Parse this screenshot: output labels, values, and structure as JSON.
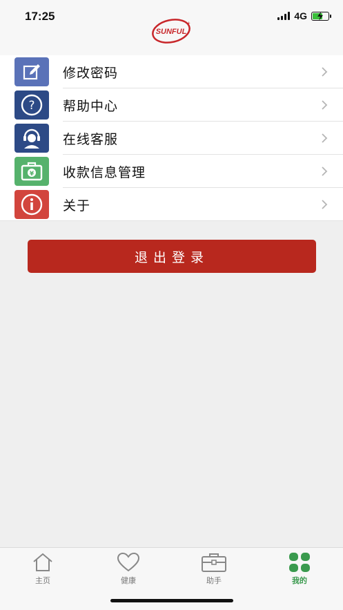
{
  "status": {
    "time": "17:25",
    "network": "4G"
  },
  "logo": {
    "text": "SUNFUL"
  },
  "menu": [
    {
      "label": "修改密码",
      "icon": "edit-icon",
      "color": "#5a72b8"
    },
    {
      "label": "帮助中心",
      "icon": "help-icon",
      "color": "#2d4a86"
    },
    {
      "label": "在线客服",
      "icon": "customer-service-icon",
      "color": "#2d4a86"
    },
    {
      "label": "收款信息管理",
      "icon": "wallet-icon",
      "color": "#56b26c"
    },
    {
      "label": "关于",
      "icon": "info-icon",
      "color": "#d2453d"
    }
  ],
  "logout": {
    "label": "退出登录",
    "color": "#b8281e"
  },
  "tabs": [
    {
      "label": "主页",
      "icon": "home-icon"
    },
    {
      "label": "健康",
      "icon": "heart-icon"
    },
    {
      "label": "助手",
      "icon": "toolbox-icon"
    },
    {
      "label": "我的",
      "icon": "grid-icon",
      "active": true
    }
  ],
  "colors": {
    "accent": "#3a9a4e",
    "background": "#efefef"
  }
}
